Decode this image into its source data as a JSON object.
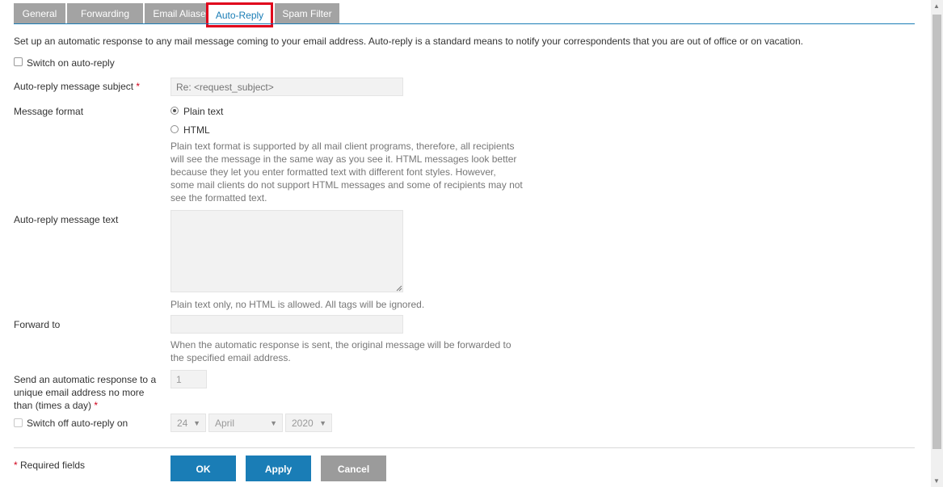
{
  "tabs": [
    {
      "label": "General",
      "active": false
    },
    {
      "label": "Forwarding",
      "active": false
    },
    {
      "label": "Email Aliases",
      "active": false
    },
    {
      "label": "Auto-Reply",
      "active": true
    },
    {
      "label": "Spam Filter",
      "active": false
    }
  ],
  "intro": "Set up an automatic response to any mail message coming to your email address. Auto-reply is a standard means to notify your correspondents that you are out of office or on vacation.",
  "switch_on": {
    "label": "Switch on auto-reply",
    "checked": false
  },
  "subject": {
    "label": "Auto-reply message subject",
    "required_mark": "*",
    "placeholder": "Re: <request_subject>"
  },
  "format": {
    "label": "Message format",
    "options": [
      {
        "label": "Plain text",
        "checked": true
      },
      {
        "label": "HTML",
        "checked": false
      }
    ],
    "hint_lines": [
      "Plain text format is supported by all mail client programs, therefore, all recipients",
      "will see the message in the same way as you see it. HTML messages look better",
      "because they let you enter formatted text with different font styles. However,",
      "some mail clients do not support HTML messages and some of recipients may not",
      "see the formatted text."
    ]
  },
  "message_text": {
    "label": "Auto-reply message text",
    "value": "",
    "hint": "Plain text only, no HTML is allowed. All tags will be ignored."
  },
  "forward_to": {
    "label": "Forward to",
    "value": "",
    "hint_lines": [
      "When the automatic response is sent, the original message will be forwarded to",
      "the specified email address."
    ]
  },
  "frequency": {
    "label_lines": [
      "Send an automatic response to a",
      "unique email address no more",
      "than (times a day)"
    ],
    "required_mark": "*",
    "value": "1"
  },
  "switch_off": {
    "label": "Switch off auto-reply on",
    "checked": false,
    "day": "24",
    "month": "April",
    "year": "2020"
  },
  "footer": {
    "required_mark": "*",
    "required_text": "Required fields",
    "ok": "OK",
    "apply": "Apply",
    "cancel": "Cancel"
  },
  "colors": {
    "accent": "#1a7db6",
    "tab_inactive": "#a3a3a3",
    "highlight": "#e0001b",
    "required": "#d0021b"
  }
}
